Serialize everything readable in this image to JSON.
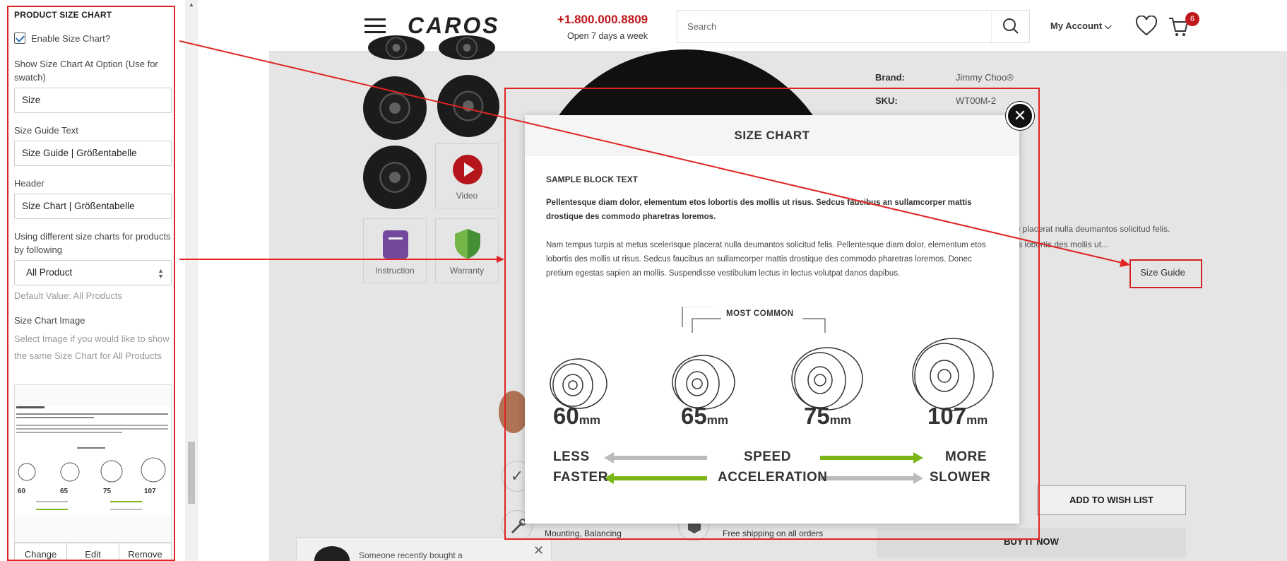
{
  "settings": {
    "section_title": "PRODUCT SIZE CHART",
    "enable_label": "Enable Size Chart?",
    "show_at_label": "Show Size Chart At Option (Use for swatch)",
    "show_at_value": "Size",
    "guide_text_label": "Size Guide Text",
    "guide_text_value": "Size Guide | Größentabelle",
    "header_label": "Header",
    "header_value": "Size Chart | Größentabelle",
    "diff_label": "Using different size charts for products by following",
    "diff_value": "All Product",
    "default_value": "Default Value: All Products",
    "image_label": "Size Chart Image",
    "image_help": "Select Image if you would like to show the same Size Chart for All Products",
    "buttons": {
      "change": "Change",
      "edit": "Edit",
      "remove": "Remove"
    }
  },
  "store": {
    "logo": "CAROS",
    "phone": "+1.800.000.8809",
    "hours": "Open 7 days a week",
    "search_placeholder": "Search",
    "my_account": "My Account",
    "cart_count": "6",
    "brand_label": "Brand:",
    "brand_value": "Jimmy Choo®",
    "sku_label": "SKU:",
    "sku_value": "WT00M-2",
    "desc_fragment_1": "ue placerat nulla deumantos solicitud felis.",
    "desc_fragment_2": "tos lobortis des mollis ut...",
    "size_guide": "Size Guide",
    "add_to_wish": "ADD TO WISH LIST",
    "buy_now": "BUY IT NOW",
    "video": "Video",
    "instruction": "Instruction",
    "warranty": "Warranty",
    "mounting": "Mounting, Balancing",
    "free_shipping": "Free shipping on all orders",
    "recent": "Someone recently bought a"
  },
  "modal": {
    "title": "SIZE CHART",
    "block_title": "SAMPLE BLOCK TEXT",
    "para1": "Pellentesque diam dolor, elementum etos lobortis des mollis ut risus. Sedcus faucibus an sullamcorper mattis drostique des commodo pharetras loremos.",
    "para2": "Nam tempus turpis at metus scelerisque placerat nulla deumantos solicitud felis. Pellentesque diam dolor, elementum etos lobortis des mollis ut risus. Sedcus faucibus an sullamcorper mattis drostique des commodo pharetras loremos. Donec pretium egestas sapien an mollis. Suspendisse vestibulum lectus in lectus volutpat danos dapibus.",
    "most_common": "MOST COMMON",
    "sizes": [
      {
        "num": "60",
        "unit": "mm"
      },
      {
        "num": "65",
        "unit": "mm"
      },
      {
        "num": "75",
        "unit": "mm"
      },
      {
        "num": "107",
        "unit": "mm"
      }
    ],
    "less": "LESS",
    "speed": "SPEED",
    "more": "MORE",
    "faster": "FASTER",
    "acceleration": "ACCELERATION",
    "slower": "SLOWER"
  },
  "colors": {
    "annotation_red": "#e02424",
    "brand_red": "#c0181d",
    "arrow_green": "#7cb518",
    "arrow_grey": "#bbbbbb"
  }
}
